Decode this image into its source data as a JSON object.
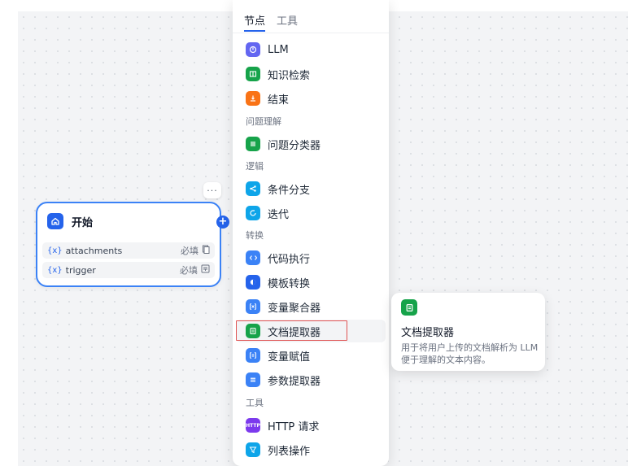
{
  "start_node": {
    "more_label": "···",
    "title": "开始",
    "variables": [
      {
        "prefix": "{x}",
        "name": "attachments",
        "required": "必填",
        "type_icon": "file-icon"
      },
      {
        "prefix": "{x}",
        "name": "trigger",
        "required": "必填",
        "type_icon": "list-icon"
      }
    ],
    "plus_label": "+"
  },
  "panel": {
    "tabs": [
      {
        "label": "节点",
        "active": true
      },
      {
        "label": "工具",
        "active": false
      }
    ],
    "groups": [
      {
        "section": "",
        "items": [
          {
            "label": "LLM",
            "color": "#6366f1",
            "icon": "llm-icon"
          },
          {
            "label": "知识检索",
            "color": "#16a34a",
            "icon": "book-icon"
          },
          {
            "label": "结束",
            "color": "#f97316",
            "icon": "end-icon"
          }
        ]
      },
      {
        "section": "问题理解",
        "items": [
          {
            "label": "问题分类器",
            "color": "#16a34a",
            "icon": "classifier-icon"
          }
        ]
      },
      {
        "section": "逻辑",
        "items": [
          {
            "label": "条件分支",
            "color": "#0ea5e9",
            "icon": "branch-icon"
          },
          {
            "label": "迭代",
            "color": "#0ea5e9",
            "icon": "loop-icon"
          }
        ]
      },
      {
        "section": "转换",
        "items": [
          {
            "label": "代码执行",
            "color": "#3b82f6",
            "icon": "code-icon"
          },
          {
            "label": "模板转换",
            "color": "#2563eb",
            "icon": "template-icon"
          },
          {
            "label": "变量聚合器",
            "color": "#3b82f6",
            "icon": "variable-icon"
          },
          {
            "label": "文档提取器",
            "color": "#16a34a",
            "icon": "doc-extractor-icon"
          },
          {
            "label": "变量赋值",
            "color": "#3b82f6",
            "icon": "assign-icon"
          },
          {
            "label": "参数提取器",
            "color": "#3b82f6",
            "icon": "param-icon"
          }
        ]
      },
      {
        "section": "工具",
        "items": [
          {
            "label": "HTTP 请求",
            "color": "#7c3aed",
            "icon": "http-icon"
          },
          {
            "label": "列表操作",
            "color": "#0ea5e9",
            "icon": "list-op-icon"
          }
        ]
      }
    ]
  },
  "tooltip": {
    "title": "文档提取器",
    "description": "用于将用户上传的文档解析为 LLM 便于理解的文本内容。",
    "icon_color": "#16a34a"
  }
}
